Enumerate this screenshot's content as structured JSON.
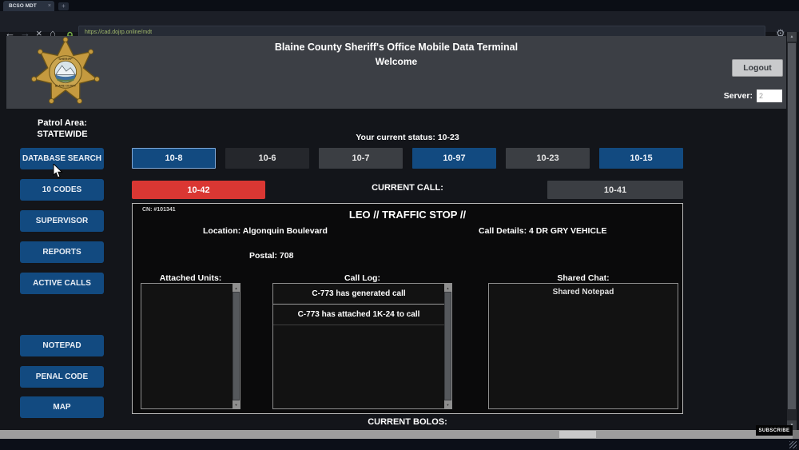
{
  "browser": {
    "tab_title": "BCSO MDT",
    "url": "https://cad.dojrp.online/mdt"
  },
  "icons": {
    "back": "←",
    "forward": "→",
    "stop": "×",
    "home": "⌂",
    "gear": "⚙",
    "close": "×",
    "new_tab": "+",
    "scroll_up": "▲",
    "scroll_down": "▼"
  },
  "header": {
    "title": "Blaine County Sheriff's Office Mobile Data Terminal",
    "subtitle": "Welcome",
    "logout_label": "Logout",
    "server_label": "Server:",
    "server_value": "2"
  },
  "sidebar": {
    "patrol_area_label": "Patrol Area:",
    "patrol_area_value": "STATEWIDE",
    "buttons_top": [
      "DATABASE SEARCH",
      "10 CODES",
      "SUPERVISOR",
      "REPORTS",
      "ACTIVE CALLS"
    ],
    "buttons_bottom": [
      "NOTEPAD",
      "PENAL CODE",
      "MAP"
    ]
  },
  "status": {
    "current_status_text": "Your current status: 10-23",
    "buttons": [
      {
        "label": "10-8",
        "variant": "blue-active"
      },
      {
        "label": "10-6",
        "variant": "dark"
      },
      {
        "label": "10-7",
        "variant": "gray"
      },
      {
        "label": "10-97",
        "variant": "blue"
      },
      {
        "label": "10-23",
        "variant": "gray"
      },
      {
        "label": "10-15",
        "variant": "blue"
      }
    ],
    "emergency_button_label": "10-42",
    "current_call_label": "CURRENT CALL:",
    "busy_button_label": "10-41"
  },
  "call": {
    "cn_text": "CN: #101341",
    "title": "LEO // TRAFFIC STOP //",
    "location": "Location: Algonquin Boulevard",
    "details": "Call Details: 4 DR GRY VEHICLE",
    "postal": "Postal: 708",
    "attached_units_label": "Attached Units:",
    "attached_units": [],
    "call_log_label": "Call Log:",
    "call_log": [
      "C-773 has generated call",
      "C-773 has attached 1K-24 to call"
    ],
    "shared_chat_label": "Shared Chat:",
    "shared_chat_text": "Shared Notepad"
  },
  "footer": {
    "current_bolos_label": "CURRENT BOLOS:",
    "watermark": "SUBSCRIBE"
  },
  "colors": {
    "accent_blue": "#124a80",
    "alert_red": "#da3733",
    "button_gray": "#3b3e43",
    "button_dark": "#25272c",
    "header_bg": "#3c3f45",
    "page_bg": "#13151a",
    "url_text": "#a4bc6d",
    "lock_green": "#79b349"
  }
}
